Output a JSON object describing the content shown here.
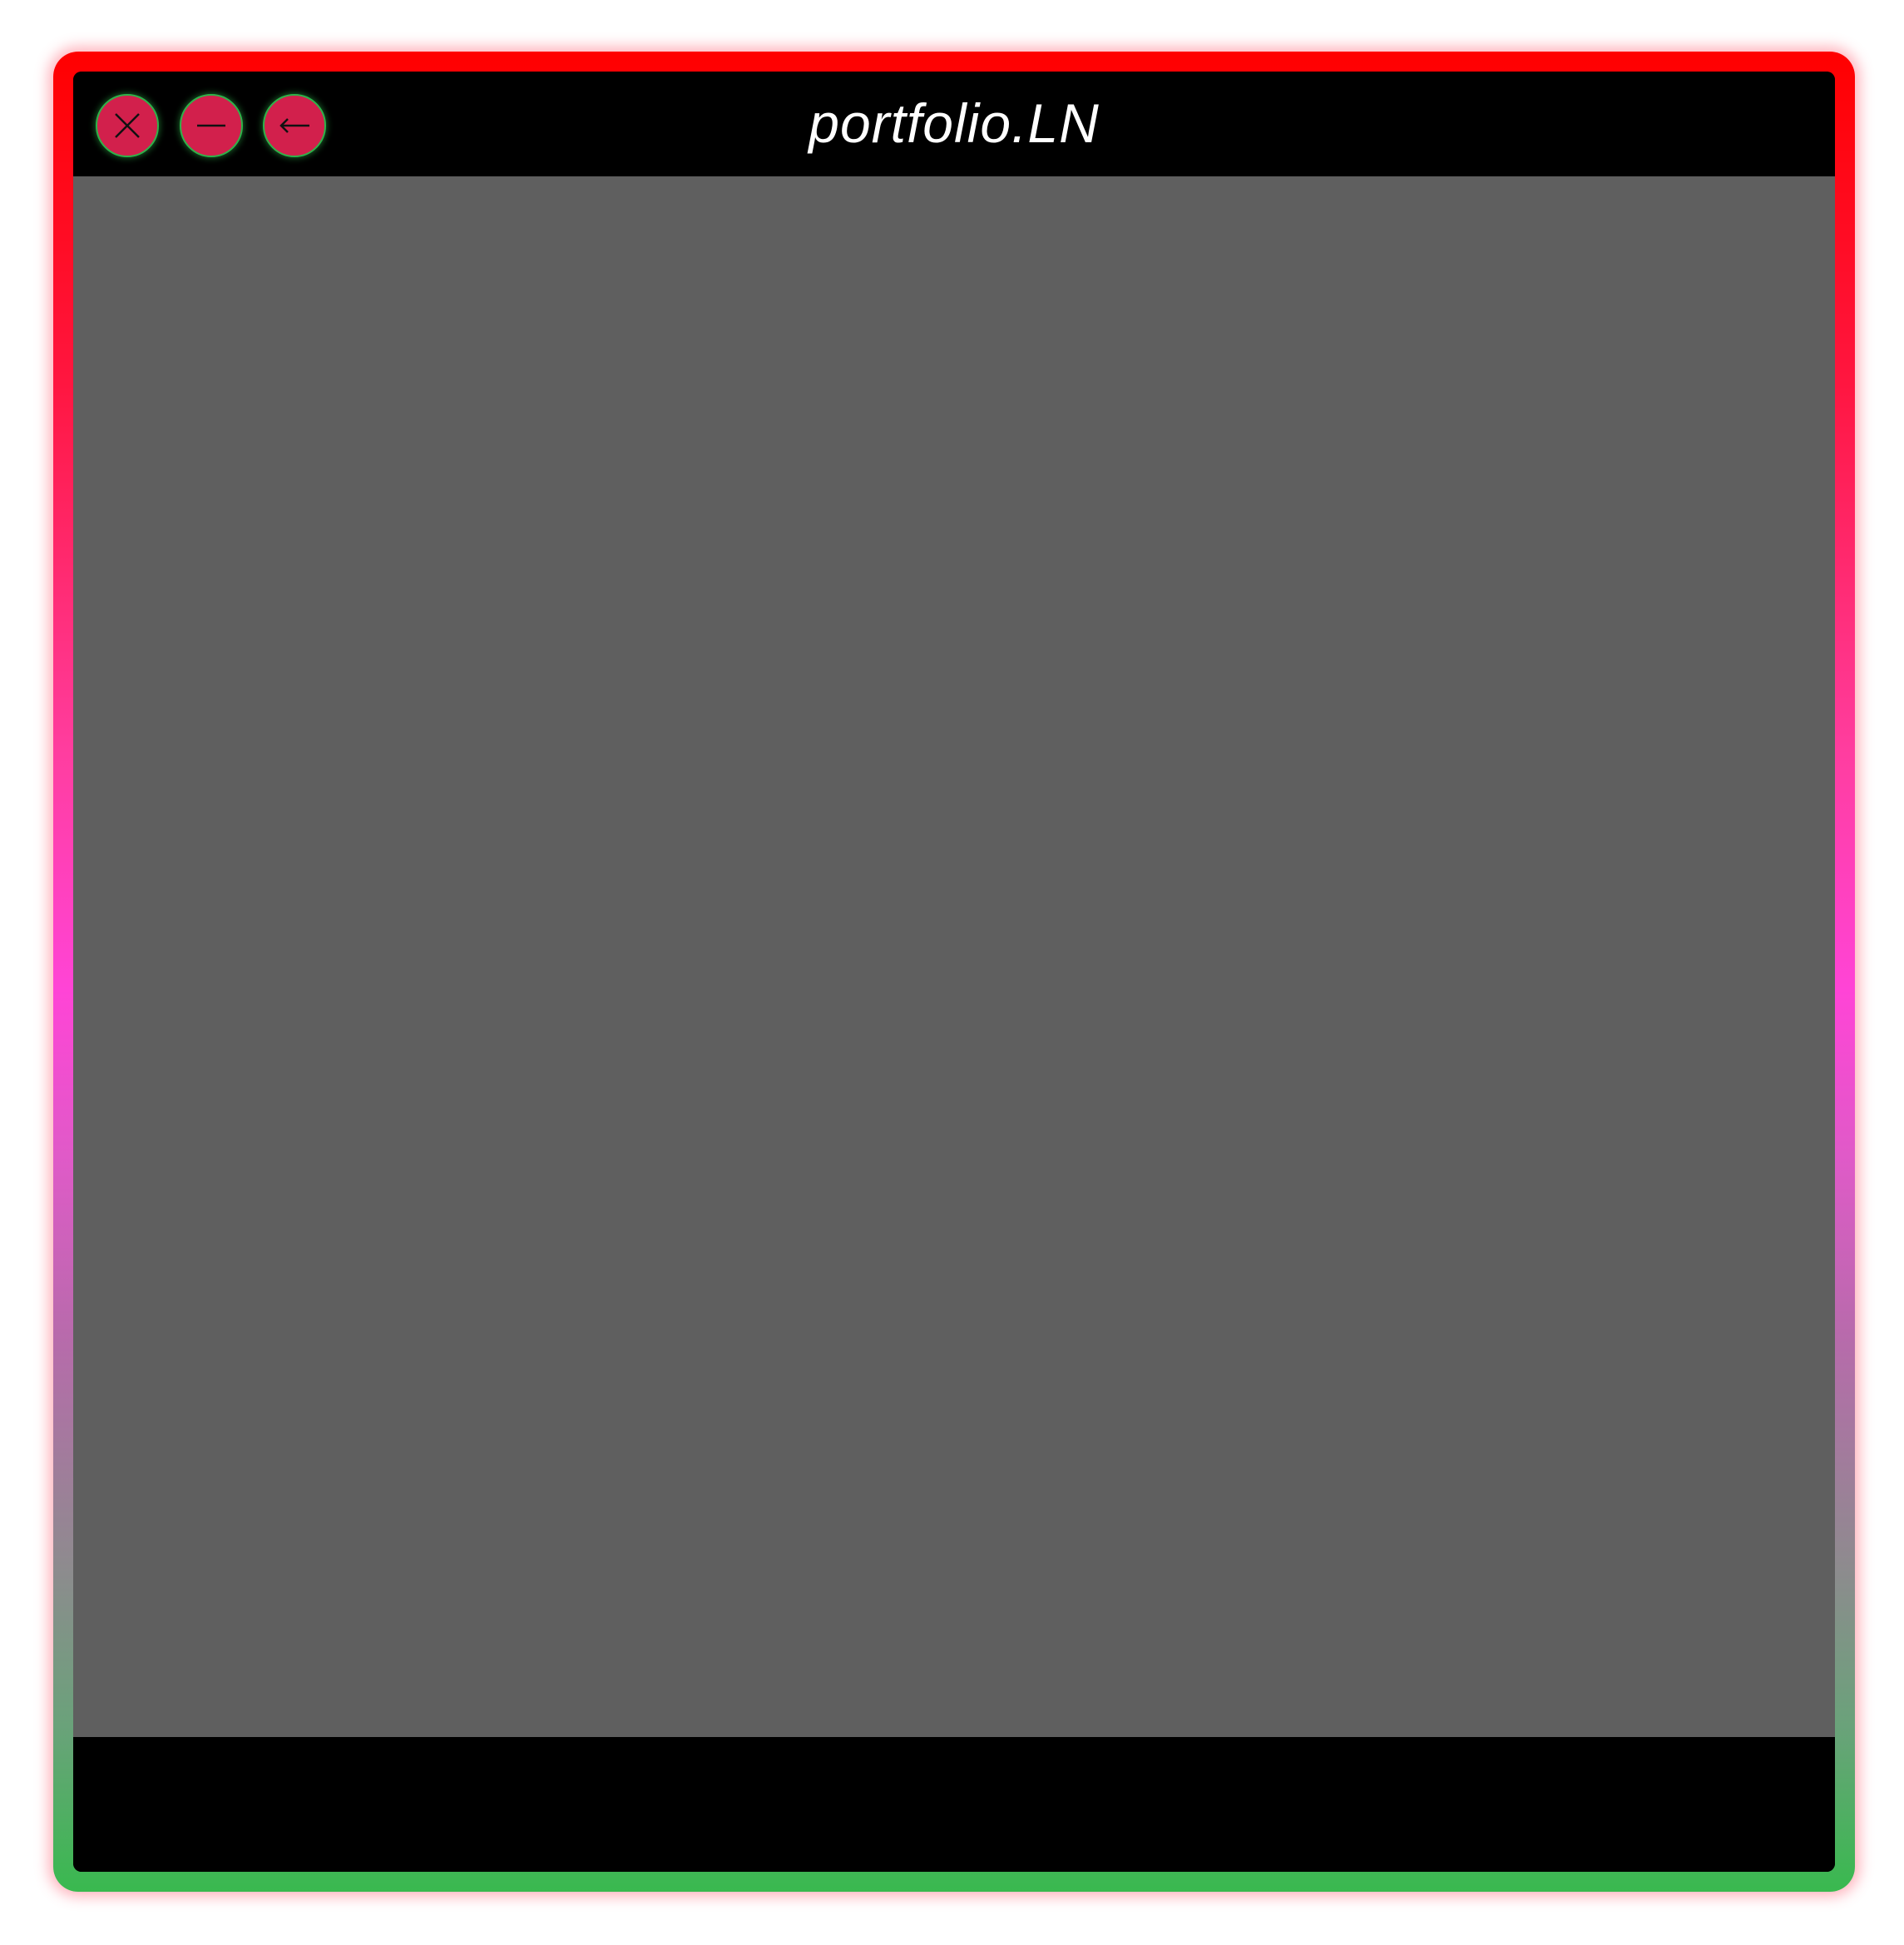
{
  "window": {
    "title": "portfolio.LN",
    "controls": {
      "close_icon": "close-icon",
      "minimize_icon": "minimize-icon",
      "back_icon": "back-arrow-icon"
    }
  },
  "colors": {
    "border_top": "#ff0000",
    "border_middle": "#ff44d6",
    "border_bottom": "#39b94f",
    "titlebar": "#000000",
    "content": "#5f5f5f",
    "footer": "#000000",
    "control_fill": "#d2204c",
    "control_ring": "#2fb24a",
    "title_text": "#ffffff"
  }
}
